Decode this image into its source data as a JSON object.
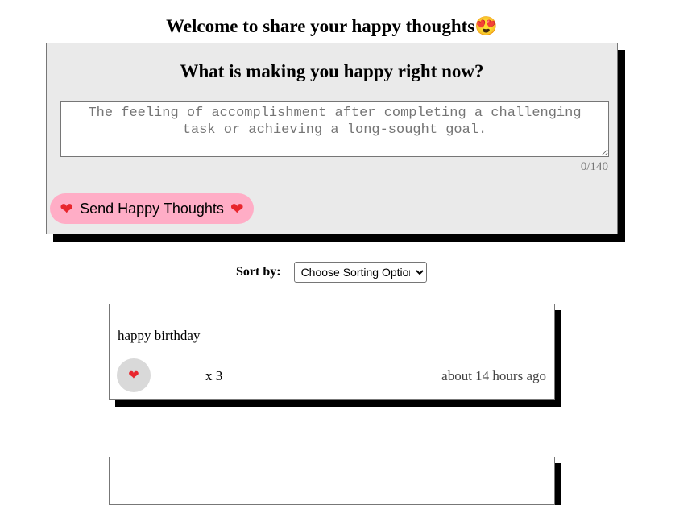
{
  "header": {
    "title": "Welcome to share your happy thoughts😍"
  },
  "form": {
    "question": "What is making you happy right now?",
    "placeholder": "The feeling of accomplishment after completing a challenging task or achieving a long-sought goal.",
    "value": "",
    "char_count": "0/140",
    "send_label": "Send Happy Thoughts",
    "heart_glyph": "❤"
  },
  "sort": {
    "label": "Sort by:",
    "selected": "Choose Sorting Option"
  },
  "thoughts": [
    {
      "message": "happy birthday",
      "likes_text": "x 3",
      "time": "about 14 hours ago"
    }
  ],
  "colors": {
    "form_bg": "#eaeaea",
    "button_pink": "#ffadc6",
    "heart_red": "#e8262d",
    "like_button_gray": "#d9d9d9",
    "shadow": "#000000"
  },
  "icons": {
    "heart": "heart-icon",
    "select_chevron": "chevron-down-icon"
  }
}
